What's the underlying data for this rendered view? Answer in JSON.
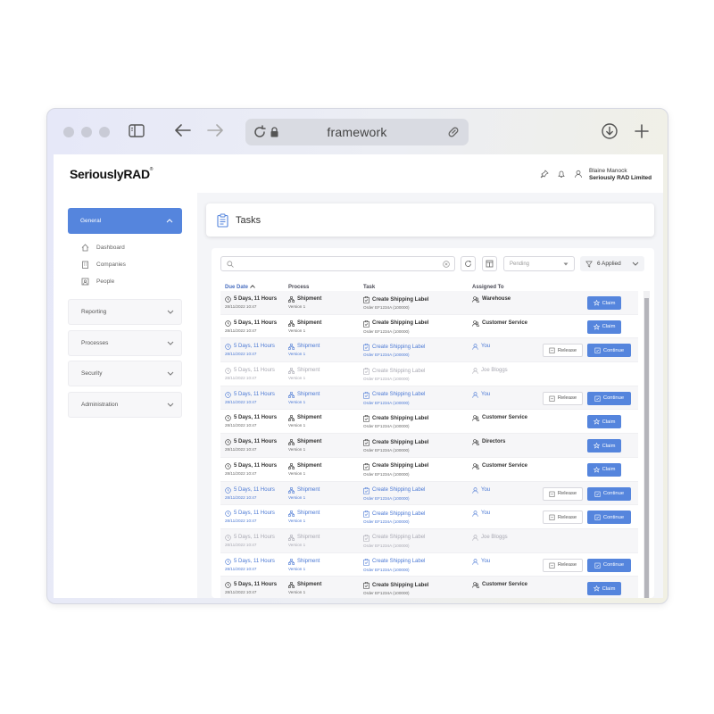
{
  "browser": {
    "url": "framework"
  },
  "header": {
    "logo": "SeriouslyRAD",
    "logo_mark": "®",
    "user_name": "Blaine Manock",
    "company": "Seriously RAD Limited"
  },
  "sidebar": {
    "active": "General",
    "sub_items": [
      "Dashboard",
      "Companies",
      "People"
    ],
    "groups": [
      "Reporting",
      "Processes",
      "Security",
      "Administration"
    ]
  },
  "page": {
    "title": "Tasks"
  },
  "toolbar": {
    "status_select": "Pending",
    "filter_label": "6 Applied"
  },
  "columns": {
    "due": "Due Date",
    "process": "Process",
    "task": "Task",
    "assigned": "Assigned To"
  },
  "buttons": {
    "claim": "Claim",
    "release": "Release",
    "continue": "Continue"
  },
  "rows": [
    {
      "due": "5 Days, 11 Hours",
      "date": "28/11/2022 10:47",
      "process": "Shipment",
      "version": "Version 1",
      "task": "Create Shipping Label",
      "order": "Order EF1234A (100000)",
      "assigned": "Warehouse",
      "state": "claim"
    },
    {
      "due": "5 Days, 11 Hours",
      "date": "28/11/2022 10:47",
      "process": "Shipment",
      "version": "Version 1",
      "task": "Create Shipping Label",
      "order": "Order EF1234A (100000)",
      "assigned": "Customer Service",
      "state": "claim"
    },
    {
      "due": "5 Days, 11 Hours",
      "date": "28/11/2022 10:47",
      "process": "Shipment",
      "version": "Version 1",
      "task": "Create Shipping Label",
      "order": "Order EF1234A (100000)",
      "assigned": "You",
      "state": "mine"
    },
    {
      "due": "5 Days, 11 Hours",
      "date": "28/11/2022 10:47",
      "process": "Shipment",
      "version": "Version 1",
      "task": "Create Shipping Label",
      "order": "Order EF1234A (100000)",
      "assigned": "Joe Bloggs",
      "state": "dim"
    },
    {
      "due": "5 Days, 11 Hours",
      "date": "28/11/2022 10:47",
      "process": "Shipment",
      "version": "Version 1",
      "task": "Create Shipping Label",
      "order": "Order EF1234A (100000)",
      "assigned": "You",
      "state": "mine"
    },
    {
      "due": "5 Days, 11 Hours",
      "date": "28/11/2022 10:47",
      "process": "Shipment",
      "version": "Version 1",
      "task": "Create Shipping Label",
      "order": "Order EF1234A (100000)",
      "assigned": "Customer Service",
      "state": "claim"
    },
    {
      "due": "5 Days, 11 Hours",
      "date": "28/11/2022 10:47",
      "process": "Shipment",
      "version": "Version 1",
      "task": "Create Shipping Label",
      "order": "Order EF1234A (100000)",
      "assigned": "Directors",
      "state": "claim"
    },
    {
      "due": "5 Days, 11 Hours",
      "date": "28/11/2022 10:47",
      "process": "Shipment",
      "version": "Version 1",
      "task": "Create Shipping Label",
      "order": "Order EF1234A (100000)",
      "assigned": "Customer Service",
      "state": "claim"
    },
    {
      "due": "5 Days, 11 Hours",
      "date": "28/11/2022 10:47",
      "process": "Shipment",
      "version": "Version 1",
      "task": "Create Shipping Label",
      "order": "Order EF1234A (100000)",
      "assigned": "You",
      "state": "mine"
    },
    {
      "due": "5 Days, 11 Hours",
      "date": "28/11/2022 10:47",
      "process": "Shipment",
      "version": "Version 1",
      "task": "Create Shipping Label",
      "order": "Order EF1234A (100000)",
      "assigned": "You",
      "state": "mine"
    },
    {
      "due": "5 Days, 11 Hours",
      "date": "28/11/2022 10:47",
      "process": "Shipment",
      "version": "Version 1",
      "task": "Create Shipping Label",
      "order": "Order EF1234A (100000)",
      "assigned": "Joe Bloggs",
      "state": "dim"
    },
    {
      "due": "5 Days, 11 Hours",
      "date": "28/11/2022 10:47",
      "process": "Shipment",
      "version": "Version 1",
      "task": "Create Shipping Label",
      "order": "Order EF1234A (100000)",
      "assigned": "You",
      "state": "mine"
    },
    {
      "due": "5 Days, 11 Hours",
      "date": "28/11/2022 10:47",
      "process": "Shipment",
      "version": "Version 1",
      "task": "Create Shipping Label",
      "order": "Order EF1234A (100000)",
      "assigned": "Customer Service",
      "state": "claim"
    }
  ],
  "colors": {
    "accent": "#5585dd",
    "mine_text": "#4a78d4",
    "dim_text": "#a8a8b2"
  }
}
